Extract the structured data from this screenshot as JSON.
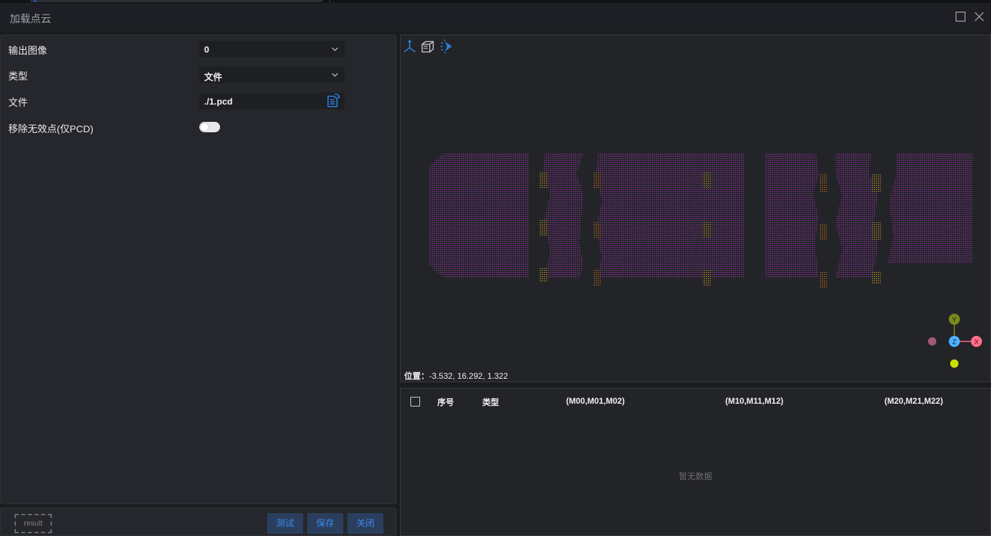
{
  "window": {
    "title": "加载点云"
  },
  "params": {
    "output_image": {
      "label": "输出图像",
      "value": "0"
    },
    "type": {
      "label": "类型",
      "value": "文件"
    },
    "file": {
      "label": "文件",
      "value": "./1.pcd"
    },
    "remove_invalid": {
      "label": "移除无效点(仅PCD)",
      "enabled": false
    }
  },
  "footer": {
    "result_label": "result",
    "test": "测试",
    "save": "保存",
    "close": "关闭"
  },
  "viewer": {
    "toolbar": [
      "axes-icon",
      "cube-view-icon",
      "point-select-icon"
    ],
    "position_label": "位置：",
    "position_value": "-3.532, 16.292, 1.322",
    "gizmo": {
      "y": "Y",
      "z": "Z",
      "x": "X",
      "colors": {
        "x": "#ff6f8a",
        "y": "#7a8a1a",
        "z": "#4fb3ff",
        "neg_x": "#a05a72",
        "neg_y": "#c8e000"
      }
    },
    "colors": {
      "primary": "#9b2fae",
      "accent_orange": "#d07010",
      "accent_yellow": "#c8a020"
    }
  },
  "table": {
    "columns": [
      "序号",
      "类型",
      "(M00,M01,M02)",
      "(M10,M11,M12)",
      "(M20,M21,M22)"
    ],
    "rows": [],
    "empty_text": "暂无数据"
  },
  "accent_color": "#2b7fe0"
}
